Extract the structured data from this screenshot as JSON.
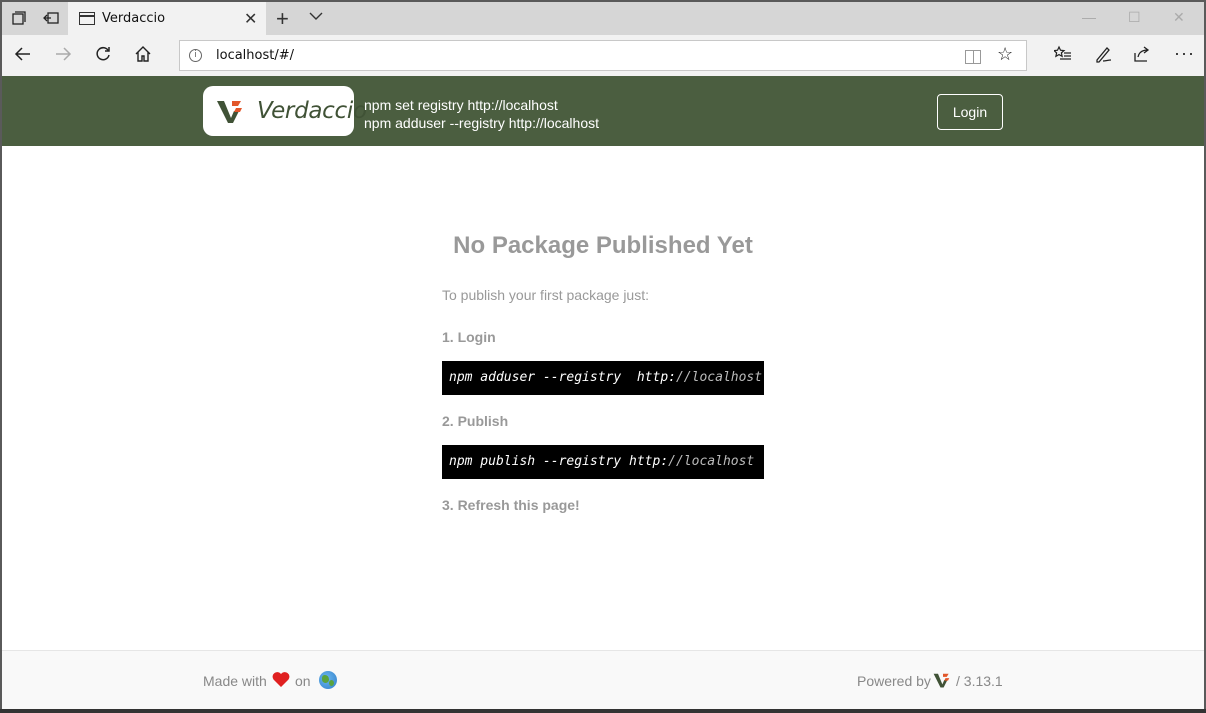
{
  "browser": {
    "tab_title": "Verdaccio",
    "url": "localhost/#/",
    "icons": {
      "tab_actions": "tab-actions-icon",
      "set_aside": "set-aside-icon",
      "page": "page-icon",
      "close_tab": "close-icon",
      "new_tab": "plus-icon",
      "tab_menu": "chevron-down-icon",
      "back": "back-arrow-icon",
      "forward": "forward-arrow-icon",
      "refresh": "refresh-icon",
      "home": "home-icon",
      "site_info": "info-icon",
      "reading_view": "reading-view-icon",
      "favorite": "star-icon",
      "favorites_hub": "favorites-list-icon",
      "notes": "pen-icon",
      "share": "share-icon",
      "more": "more-icon"
    }
  },
  "header": {
    "logo_text": "Verdaccio",
    "cmd_registry": "npm set registry http://localhost",
    "cmd_adduser": "npm adduser --registry http://localhost",
    "login_label": "Login",
    "bg_color": "#4b5e40"
  },
  "main": {
    "title": "No Package Published Yet",
    "intro": "To publish your first package just:",
    "step1": "1. Login",
    "code1_cmd": "npm adduser --registry  http:",
    "code1_url": "//localhost",
    "step2": "2. Publish",
    "code2_cmd": "npm publish --registry http:",
    "code2_url": "//localhost",
    "step3": "3. Refresh this page!"
  },
  "footer": {
    "made_with": "Made with",
    "on": "on",
    "powered_by": "Powered by",
    "version": "/ 3.13.1",
    "heart_color": "#e02020"
  }
}
